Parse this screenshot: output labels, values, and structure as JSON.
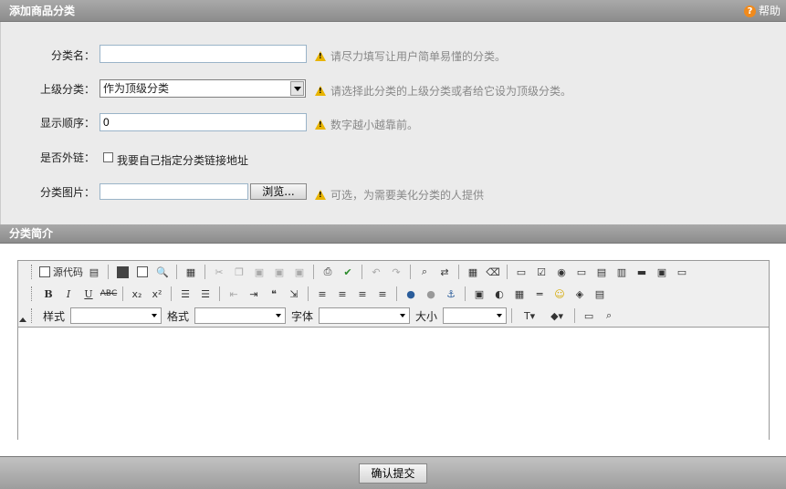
{
  "header": {
    "title": "添加商品分类",
    "help_label": "帮助"
  },
  "form": {
    "name_label": "分类名：",
    "name_value": "",
    "name_hint": "请尽力填写让用户简单易懂的分类。",
    "parent_label": "上级分类：",
    "parent_value": "作为顶级分类",
    "parent_hint": "请选择此分类的上级分类或者给它设为顶级分类。",
    "order_label": "显示顺序：",
    "order_value": "0",
    "order_hint": "数字越小越靠前。",
    "link_label": "是否外链：",
    "link_checkbox_label": "我要自己指定分类链接地址",
    "image_label": "分类图片：",
    "image_value": "",
    "browse_label": "浏览...",
    "image_hint": "可选，为需要美化分类的人提供"
  },
  "description": {
    "title": "分类简介"
  },
  "editor": {
    "source_label": "源代码",
    "style_label": "样式",
    "format_label": "格式",
    "font_label": "字体",
    "size_label": "大小",
    "style_value": "",
    "format_value": "",
    "font_value": "",
    "size_value": ""
  },
  "footer": {
    "submit_label": "确认提交"
  },
  "colors": {
    "header_bg": "#9b9b9b",
    "form_bg": "#ebebeb",
    "warning": "#e8b400",
    "help": "#f08a1c"
  }
}
